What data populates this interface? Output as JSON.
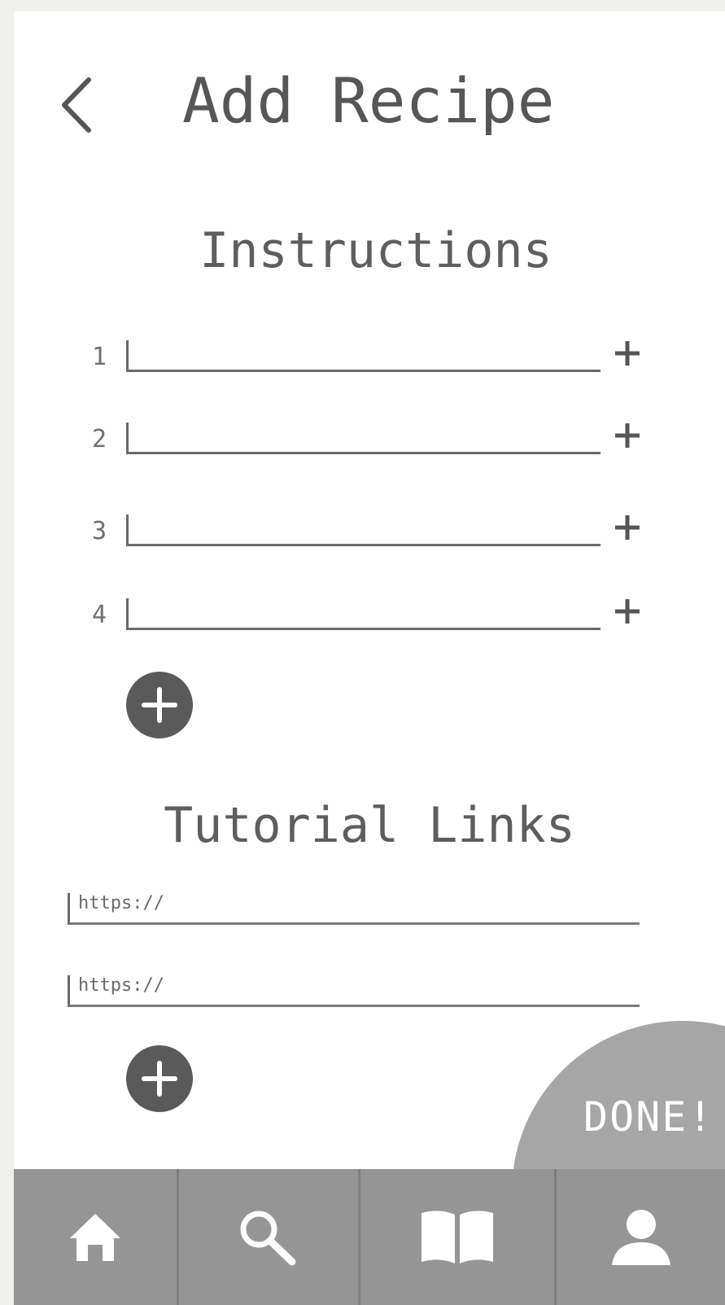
{
  "header": {
    "title": "Add Recipe",
    "back_icon": "chevron-left-icon"
  },
  "instructions": {
    "title": "Instructions",
    "steps": [
      {
        "number": "1",
        "value": ""
      },
      {
        "number": "2",
        "value": ""
      },
      {
        "number": "3",
        "value": ""
      },
      {
        "number": "4",
        "value": ""
      }
    ],
    "add_icon": "plus-icon"
  },
  "tutorial_links": {
    "title": "Tutorial Links",
    "links": [
      {
        "placeholder": "https://",
        "value": ""
      },
      {
        "placeholder": "https://",
        "value": ""
      }
    ]
  },
  "done_button": {
    "label": "DONE!"
  },
  "bottom_nav": {
    "items": [
      {
        "icon": "home-icon"
      },
      {
        "icon": "search-icon"
      },
      {
        "icon": "book-icon"
      },
      {
        "icon": "user-icon"
      }
    ]
  },
  "colors": {
    "background": "#ffffff",
    "text": "#565656",
    "nav_bar": "#959595",
    "done_blob": "#a6a6a6",
    "add_circle": "#5a5a5a"
  }
}
